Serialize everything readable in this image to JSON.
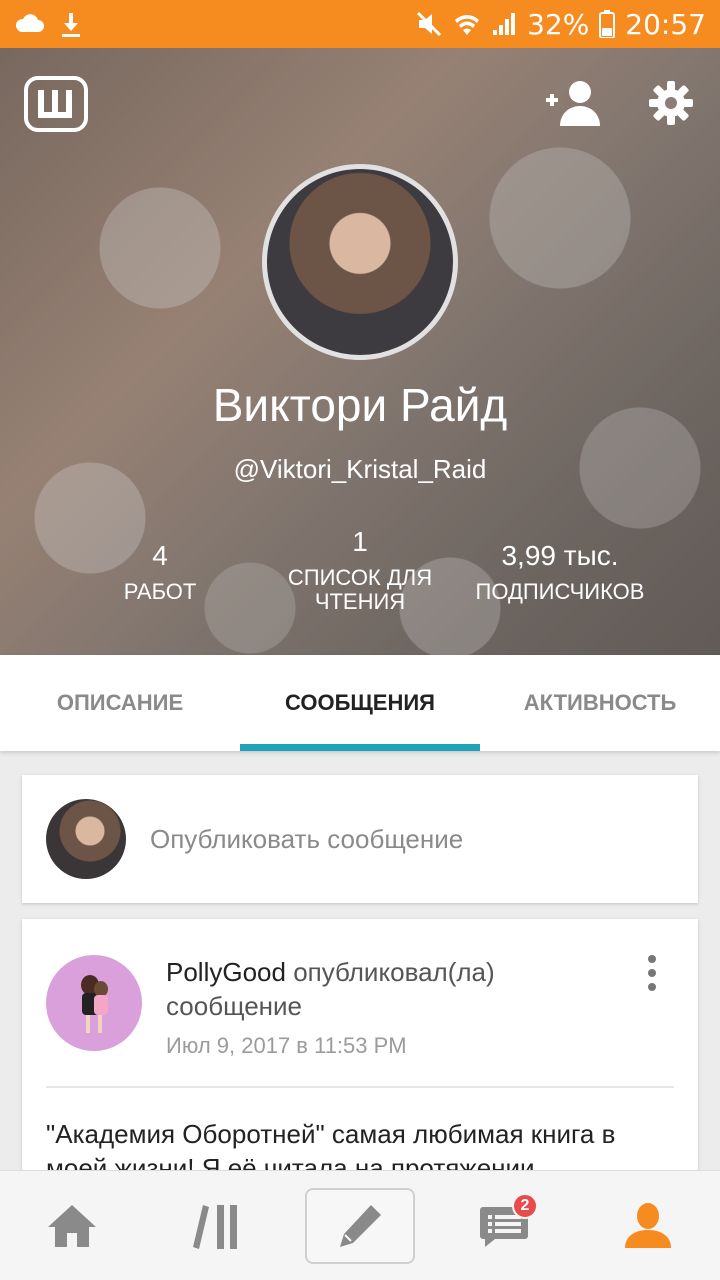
{
  "status_bar": {
    "battery": "32%",
    "time": "20:57",
    "icons": [
      "cloud-icon",
      "download-icon",
      "mute-icon",
      "wifi-icon",
      "signal-icon",
      "battery-icon"
    ]
  },
  "header": {
    "logo": "W",
    "name": "Виктори Райд",
    "handle": "@Viktori_Kristal_Raid",
    "stats": [
      {
        "value": "4",
        "label": "РАБОТ"
      },
      {
        "value": "1",
        "label": "СПИСОК ДЛЯ ЧТЕНИЯ"
      },
      {
        "value": "3,99 тыс.",
        "label": "ПОДПИСЧИКОВ"
      }
    ]
  },
  "tabs": [
    {
      "label": "ОПИСАНИЕ",
      "active": false
    },
    {
      "label": "СООБЩЕНИЯ",
      "active": true
    },
    {
      "label": "АКТИВНОСТЬ",
      "active": false
    }
  ],
  "compose": {
    "placeholder": "Опубликовать сообщение"
  },
  "post": {
    "author": "PollyGood",
    "action": "опубликовал(ла) сообщение",
    "date": "Июл 9, 2017 в 11:53 PM",
    "body": "\"Академия Оборотней\" самая любимая книга в моей жизни! Я её читала на протяжении"
  },
  "bottom_nav": {
    "messages_badge": "2",
    "items": [
      "home-icon",
      "library-icon",
      "write-icon",
      "messages-icon",
      "profile-icon"
    ]
  },
  "colors": {
    "status_bar": "#f68c1f",
    "tab_indicator": "#1fa3b8",
    "profile_active": "#f68c1f",
    "badge": "#e94b4b"
  }
}
